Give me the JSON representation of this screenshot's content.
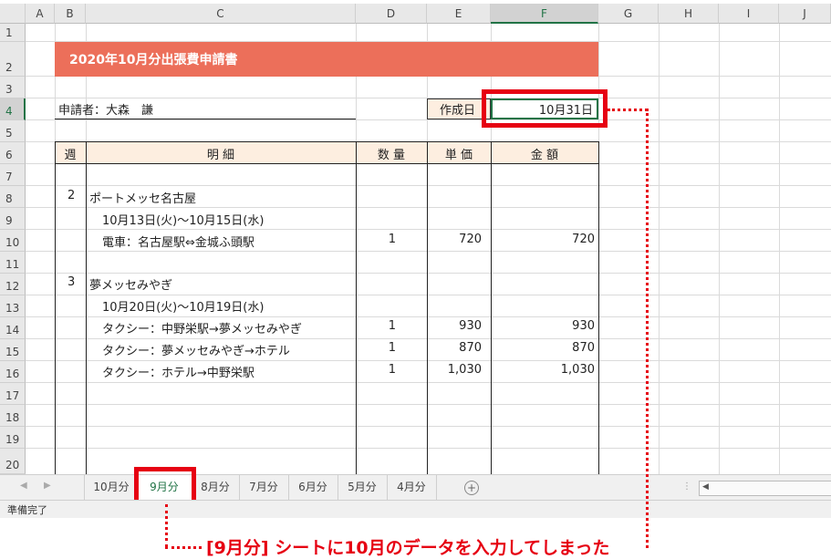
{
  "columns": [
    "A",
    "B",
    "C",
    "D",
    "E",
    "F",
    "G",
    "H",
    "I",
    "J"
  ],
  "rows": [
    "1",
    "2",
    "3",
    "4",
    "5",
    "6",
    "7",
    "8",
    "9",
    "10",
    "11",
    "12",
    "13",
    "14",
    "15",
    "16",
    "17",
    "18",
    "19",
    "20"
  ],
  "title": "2020年10月分出張費申請書",
  "applicant": "申請者：大森　謙",
  "created_label": "作成日",
  "created_value": "10月31日",
  "headers": {
    "week": "週",
    "detail": "明 細",
    "qty": "数 量",
    "unit": "単 価",
    "amount": "金 額"
  },
  "body": {
    "w1": "2",
    "place1": "ポートメッセ名古屋",
    "date1": "10月13日(火)～10月15日(水)",
    "item1": "電車：名古屋駅⇔金城ふ頭駅",
    "qty1": "1",
    "unit1": "720",
    "amt1": "720",
    "w2": "3",
    "place2": "夢メッセみやぎ",
    "date2": "10月20日(火)～10月19日(水)",
    "item2": "タクシー：中野栄駅→夢メッセみやぎ",
    "qty2": "1",
    "unit2": "930",
    "amt2": "930",
    "item3": "タクシー：夢メッセみやぎ→ホテル",
    "qty3": "1",
    "unit3": "870",
    "amt3": "870",
    "item4": "タクシー：ホテル→中野栄駅",
    "qty4": "1",
    "unit4": "1,030",
    "amt4": "1,030"
  },
  "tabs": [
    "10月分",
    "9月分",
    "8月分",
    "7月分",
    "6月分",
    "5月分",
    "4月分"
  ],
  "active_tab": "9月分",
  "status": "準備完了",
  "annotation": "[9月分] シートに10月のデータを入力してしまった",
  "colors": {
    "title_bg": "#ec6f5a",
    "header_bg": "#fdeee0",
    "highlight": "#e60012",
    "excel_green": "#217346"
  }
}
